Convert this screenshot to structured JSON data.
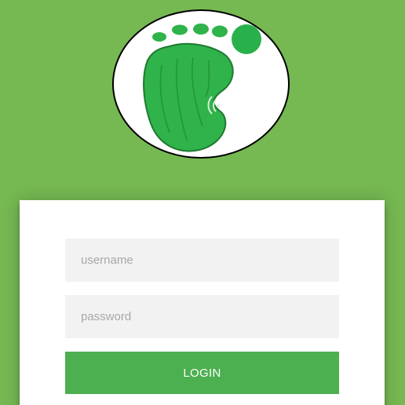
{
  "logo": {
    "icon": "footprint-icon",
    "colors": {
      "background": "#ffffff",
      "outline": "#000000",
      "foot": "#2fb34a",
      "toes": "#28b04a"
    }
  },
  "login_form": {
    "username_placeholder": "username",
    "password_placeholder": "password",
    "login_label": "LOGIN"
  },
  "theme": {
    "page_background": "#76b852",
    "card_background": "#ffffff",
    "field_background": "#f2f2f2",
    "button_background": "#4caf50",
    "button_text": "#ffffff"
  }
}
